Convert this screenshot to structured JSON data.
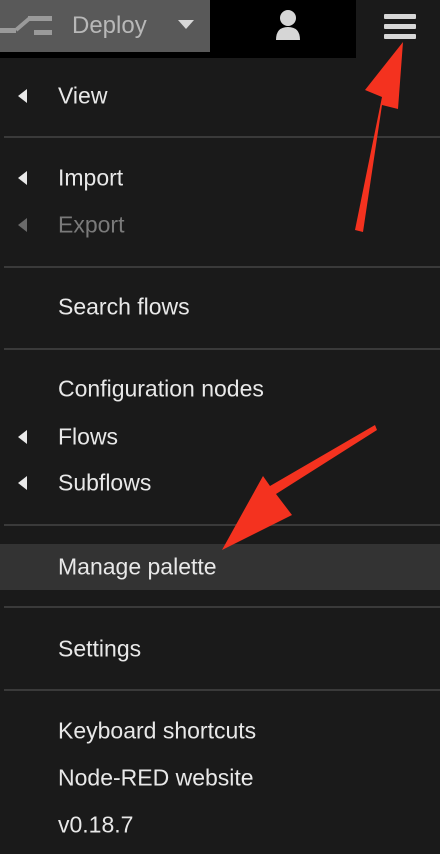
{
  "header": {
    "deploy_label": "Deploy",
    "deploy_icon": "deploy-icon",
    "user_icon": "user-icon",
    "menu_icon": "hamburger-menu-icon"
  },
  "menu": {
    "items": [
      {
        "label": "View",
        "submenu": true
      },
      {
        "label": "Import",
        "submenu": true
      },
      {
        "label": "Export",
        "submenu": true,
        "disabled": true
      },
      {
        "label": "Search flows"
      },
      {
        "label": "Configuration nodes"
      },
      {
        "label": "Flows",
        "submenu": true
      },
      {
        "label": "Subflows",
        "submenu": true
      },
      {
        "label": "Manage palette",
        "highlighted": true
      },
      {
        "label": "Settings"
      },
      {
        "label": "Keyboard shortcuts"
      },
      {
        "label": "Node-RED website"
      },
      {
        "label": "v0.18.7"
      }
    ]
  },
  "annotations": {
    "arrow_color": "#f4321f",
    "arrows": [
      "arrow-to-menu-button",
      "arrow-to-manage-palette"
    ]
  },
  "colors": {
    "background": "#1a1a1a",
    "header_background": "#000000",
    "deploy_background": "#595959",
    "highlight_background": "#333333",
    "text": "#e8e8e8",
    "disabled_text": "#7a7a7a"
  }
}
